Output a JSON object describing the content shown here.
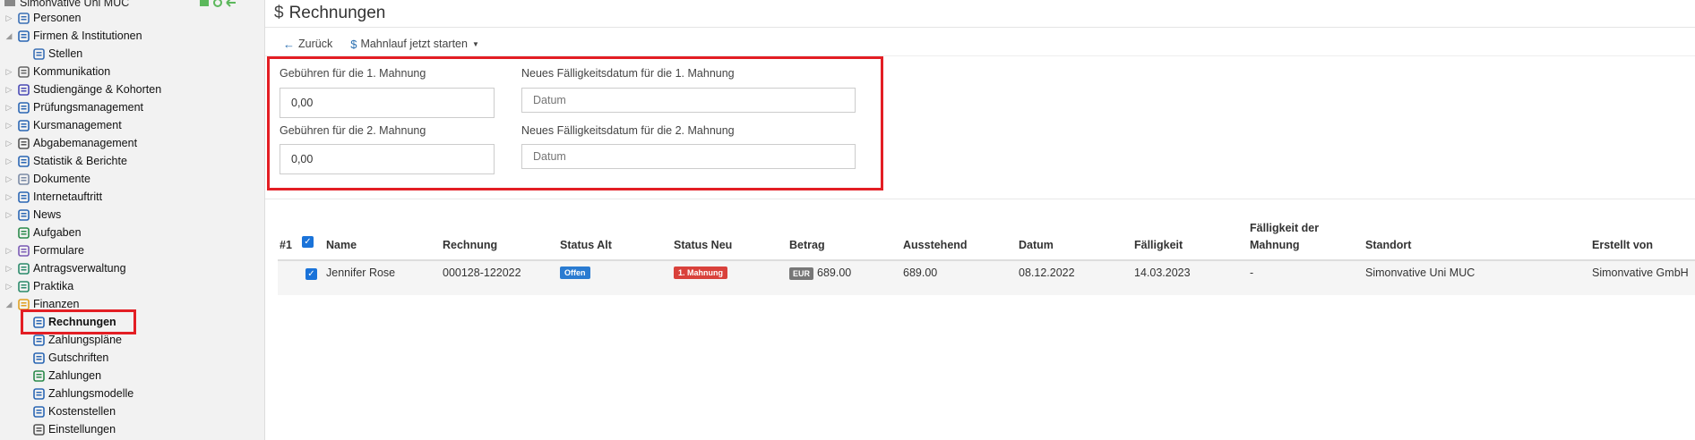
{
  "sidebar": {
    "root_label": "Simonvative Uni MUC",
    "items": [
      {
        "label": "Personen",
        "icon": "people-icon",
        "expander": "▷"
      },
      {
        "label": "Firmen & Institutionen",
        "icon": "building-icon",
        "expander": "◢"
      },
      {
        "label": "Stellen",
        "icon": "tag-icon",
        "expander": ""
      },
      {
        "label": "Kommunikation",
        "icon": "mail-icon",
        "expander": "▷"
      },
      {
        "label": "Studiengänge & Kohorten",
        "icon": "graduation-cap-icon",
        "expander": "▷"
      },
      {
        "label": "Prüfungsmanagement",
        "icon": "checklist-icon",
        "expander": "▷"
      },
      {
        "label": "Kursmanagement",
        "icon": "book-icon",
        "expander": "▷"
      },
      {
        "label": "Abgabemanagement",
        "icon": "submission-icon",
        "expander": "▷"
      },
      {
        "label": "Statistik & Berichte",
        "icon": "bar-chart-icon",
        "expander": "▷"
      },
      {
        "label": "Dokumente",
        "icon": "folder-icon",
        "expander": "▷"
      },
      {
        "label": "Internetauftritt",
        "icon": "globe-icon",
        "expander": "▷"
      },
      {
        "label": "News",
        "icon": "info-icon",
        "expander": "▷"
      },
      {
        "label": "Aufgaben",
        "icon": "clock-icon",
        "expander": ""
      },
      {
        "label": "Formulare",
        "icon": "form-icon",
        "expander": "▷"
      },
      {
        "label": "Antragsverwaltung",
        "icon": "application-icon",
        "expander": "▷"
      },
      {
        "label": "Praktika",
        "icon": "internship-icon",
        "expander": "▷"
      },
      {
        "label": "Finanzen",
        "icon": "coins-icon",
        "expander": "◢"
      },
      {
        "label": "Rechnungen",
        "icon": "invoice-icon",
        "expander": ""
      },
      {
        "label": "Zahlungspläne",
        "icon": "payment-plan-icon",
        "expander": ""
      },
      {
        "label": "Gutschriften",
        "icon": "credit-note-icon",
        "expander": ""
      },
      {
        "label": "Zahlungen",
        "icon": "money-icon",
        "expander": ""
      },
      {
        "label": "Zahlungsmodelle",
        "icon": "grid-icon",
        "expander": ""
      },
      {
        "label": "Kostenstellen",
        "icon": "cost-center-icon",
        "expander": ""
      },
      {
        "label": "Einstellungen",
        "icon": "gear-icon",
        "expander": ""
      }
    ]
  },
  "header": {
    "title": "Rechnungen"
  },
  "toolbar": {
    "back_label": "Zurück",
    "dunning_label": "Mahnlauf jetzt starten"
  },
  "form": {
    "fee1_label": "Gebühren für die 1. Mahnung",
    "fee1_value": "0,00",
    "due1_label": "Neues Fälligkeitsdatum für die 1. Mahnung",
    "due1_placeholder": "Datum",
    "fee2_label": "Gebühren für die 2. Mahnung",
    "fee2_value": "0,00",
    "due2_label": "Neues Fälligkeitsdatum für die 2. Mahnung",
    "due2_placeholder": "Datum"
  },
  "table": {
    "headers": {
      "num": "#1",
      "name": "Name",
      "invoice": "Rechnung",
      "status_old": "Status Alt",
      "status_new": "Status Neu",
      "amount": "Betrag",
      "outstanding": "Ausstehend",
      "date": "Datum",
      "due": "Fälligkeit",
      "dunning_due_1": "Fälligkeit der",
      "dunning_due_2": "Mahnung",
      "location": "Standort",
      "created_by": "Erstellt von"
    },
    "rows": [
      {
        "name": "Jennifer Rose",
        "invoice": "000128-122022",
        "status_old": "Offen",
        "status_new": "1. Mahnung",
        "currency": "EUR",
        "amount": "689.00",
        "outstanding": "689.00",
        "date": "08.12.2022",
        "due": "14.03.2023",
        "dunning_due": "-",
        "location": "Simonvative Uni MUC",
        "created_by": "Simonvative GmbH"
      }
    ]
  },
  "colors": {
    "highlight": "#e31e24",
    "status_open": "#2a7bd1",
    "status_dunning": "#d9413b",
    "checkbox": "#1a73d9"
  }
}
